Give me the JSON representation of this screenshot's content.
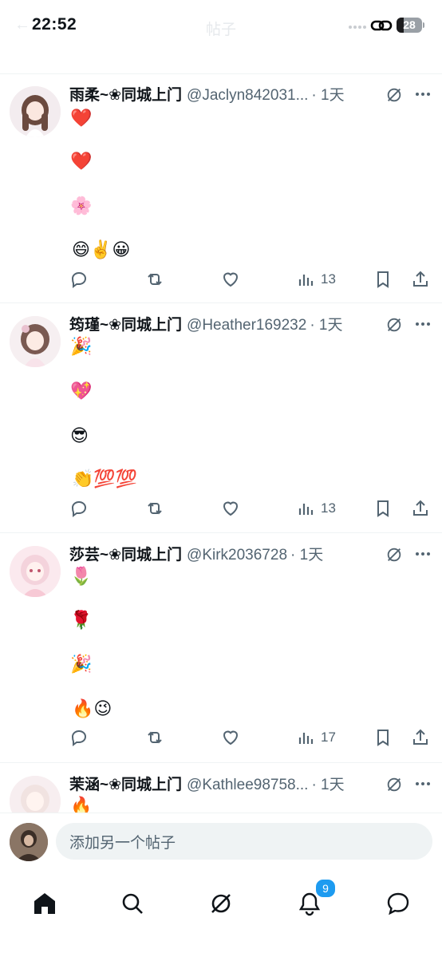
{
  "status_bar": {
    "time": "22:52",
    "battery_level": "28",
    "battery_fill_percent": 28,
    "title_behind": "帖子"
  },
  "top_row_views": "13",
  "posts": [
    {
      "name": "雨柔~❀同城上门",
      "handle": "@Jaclyn842031...",
      "time": "· 1天",
      "lines": [
        "❤️",
        "❤️",
        "🌸",
        "😄✌️😀"
      ],
      "views": "13"
    },
    {
      "name": "筠瑾~❀同城上门",
      "handle": "@Heather169232",
      "time": "· 1天",
      "lines": [
        "🎉",
        "💖",
        "😎",
        "👏💯💯"
      ],
      "views": "13"
    },
    {
      "name": "莎芸~❀同城上门",
      "handle": "@Kirk2036728",
      "time": "· 1天",
      "lines": [
        "🌷",
        "🌹",
        "🎉",
        "🔥😉"
      ],
      "views": "17"
    },
    {
      "name": "茉涵~❀同城上门",
      "handle": "@Kathlee98758...",
      "time": "· 1天",
      "lines": [
        "🔥"
      ],
      "views": ""
    }
  ],
  "compose": {
    "placeholder": "添加另一个帖子"
  },
  "tabbar": {
    "notifications_badge": "9",
    "items": [
      "home-icon",
      "search-icon",
      "grok-icon",
      "bell-icon",
      "messages-icon"
    ]
  },
  "colors": {
    "text": "#0f1419",
    "secondary": "#536471",
    "accent": "#1d9bf0",
    "divider": "#eff3f4"
  }
}
